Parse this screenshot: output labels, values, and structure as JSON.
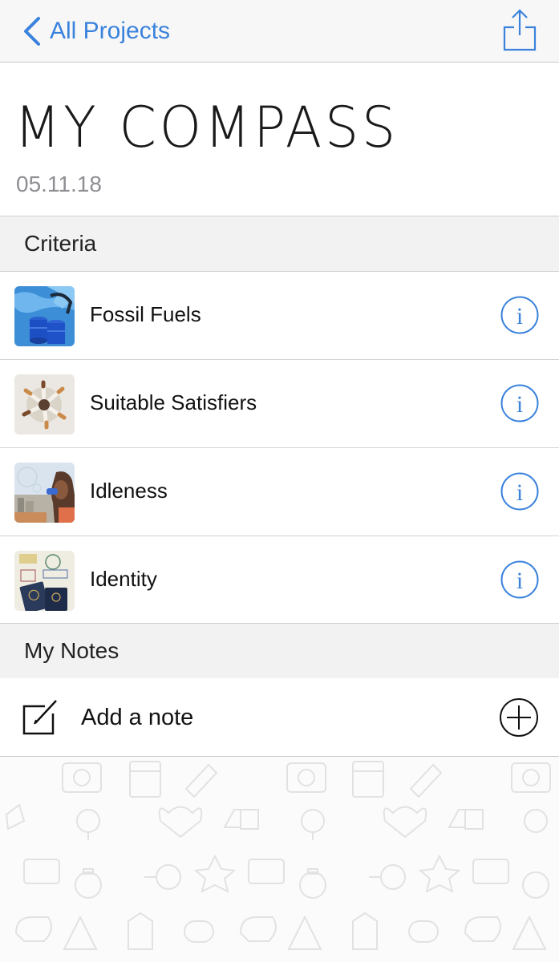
{
  "nav": {
    "back_label": "All Projects",
    "back_icon": "chevron-left-icon",
    "share_icon": "share-icon",
    "accent": "#3a82dc"
  },
  "header": {
    "title": "MY COMPASS",
    "date": "05.11.18"
  },
  "criteria": {
    "section_title": "Criteria",
    "items": [
      {
        "label": "Fossil Fuels",
        "thumb": "oil-barrels-map-thumbnail"
      },
      {
        "label": "Suitable Satisfiers",
        "thumb": "cigarette-butts-thumbnail"
      },
      {
        "label": "Idleness",
        "thumb": "person-blowing-bubbles-thumbnail"
      },
      {
        "label": "Identity",
        "thumb": "passports-stamps-thumbnail"
      }
    ]
  },
  "notes": {
    "section_title": "My Notes",
    "add_label": "Add a note"
  }
}
